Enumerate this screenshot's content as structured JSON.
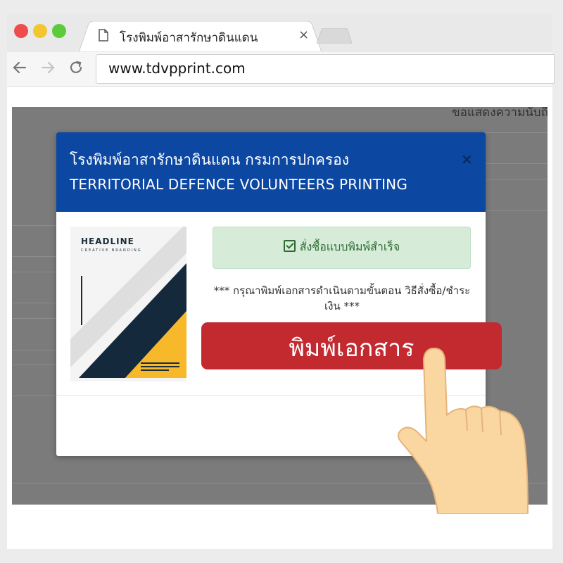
{
  "browser": {
    "tab_title": "โรงพิมพ์อาสารักษาดินแดน",
    "tab_close": "×",
    "url": "www.tdvpprint.com",
    "colors": {
      "close": "#ee4d4d",
      "minimize": "#f2c62f",
      "maximize": "#5ccb3a"
    }
  },
  "page": {
    "background_text": "ขอแสดงความนับถือ"
  },
  "modal": {
    "title_th": "โรงพิมพ์อาสารักษาดินแดน กรมการปกครอง",
    "title_en": "TERRITORIAL DEFENCE VOLUNTEERS PRINTING",
    "close": "×",
    "header_color": "#0c47a2",
    "poster": {
      "headline": "HEADLINE",
      "subtitle": "CREATIVE BRANDING"
    },
    "success_message": "สั่งซื้อแบบพิมพ์สำเร็จ",
    "instruction": "*** กรุณาพิมพ์เอกสารดำเนินตามขั้นตอน วิธีสั่งซื้อ/ชำระเงิน ***"
  },
  "print_button": {
    "label": "พิมพ์เอกสาร",
    "color": "#c32a30"
  },
  "icons": [
    "document-icon",
    "back-arrow-icon",
    "forward-arrow-icon",
    "reload-icon",
    "check-square-icon",
    "pointing-hand-icon"
  ]
}
